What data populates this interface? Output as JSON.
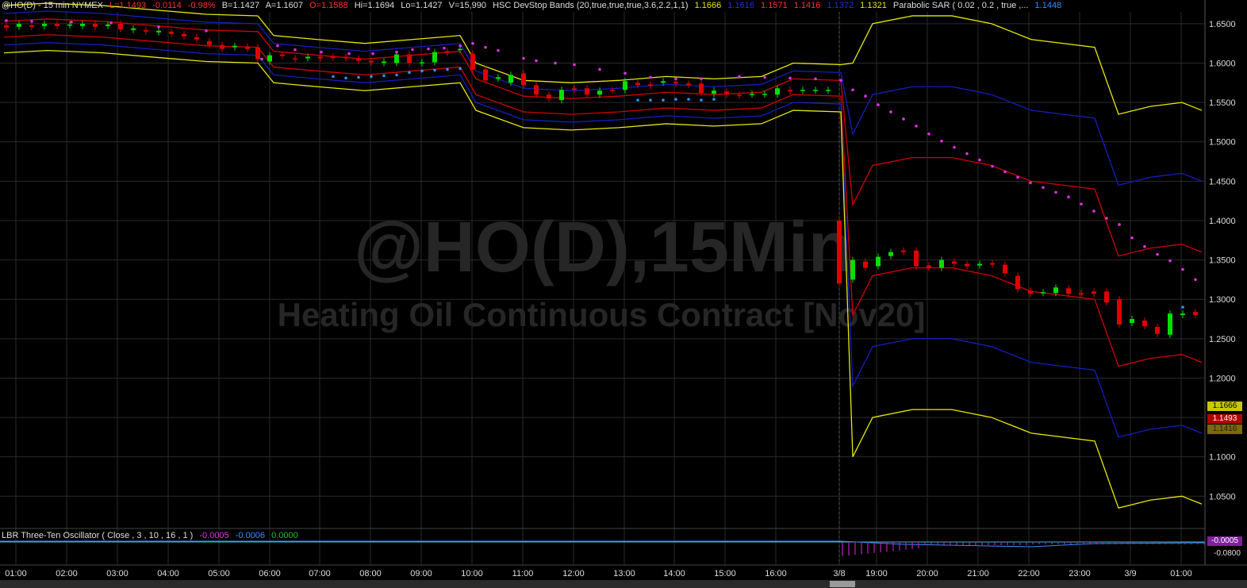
{
  "header": {
    "symbol": "@HO(D) - 15 min  NYMEX",
    "last": "L=1.1493",
    "change": "-0.0114",
    "pct": "-0.98%",
    "bid": "B=1.1427",
    "ask": "A=1.1607",
    "open": "O=1.1588",
    "high": "Hi=1.1694",
    "low": "Lo=1.1427",
    "volume": "V=15,990",
    "bands_label": "HSC DevStop Bands (20,true,true,true,3.6,2.2,1,1)",
    "band_values": [
      "1.1666",
      "1.1616",
      "1.1571",
      "1.1416",
      "1.1372",
      "1.1321"
    ],
    "sar_label": "Parabolic SAR ( 0.02 , 0.2 , true ,...",
    "sar_value": "1.1448"
  },
  "watermark": {
    "line1": "@HO(D),15Min",
    "line2": "Heating Oil Continuous Contract [Nov20]"
  },
  "oscillator": {
    "label": "LBR Three-Ten Oscillator ( Close , 3 , 10 , 16 , 1 )",
    "v1": "-0.0005",
    "v2": "-0.0006",
    "v3": "0.0000",
    "axis_labels": [
      "-0.0005",
      "-0.0800"
    ]
  },
  "price_tags": [
    "1.1666",
    "1.1493",
    "1.1416"
  ],
  "colors": {
    "up": "#00e000",
    "down": "#e00000",
    "yellow": "#e8e800",
    "blue": "#1020c0",
    "red": "#d00000",
    "sar_pink": "#e030e0",
    "sar_blue": "#3090ff"
  },
  "chart_data": {
    "type": "candlestick",
    "y_ticks": [
      "1.6500",
      "1.6000",
      "1.5500",
      "1.5000",
      "1.4500",
      "1.4000",
      "1.3500",
      "1.3000",
      "1.2500",
      "1.2000",
      "1.1500",
      "1.1000",
      "1.0500"
    ],
    "x_ticks": [
      "01:00",
      "02:00",
      "03:00",
      "04:00",
      "05:00",
      "06:00",
      "07:00",
      "08:00",
      "09:00",
      "10:00",
      "11:00",
      "12:00",
      "13:00",
      "14:00",
      "15:00",
      "16:00",
      "3/8",
      "19:00",
      "20:00",
      "21:00",
      "22:00",
      "23:00",
      "3/9",
      "01:00"
    ],
    "ylim": [
      1.01,
      1.665
    ]
  }
}
